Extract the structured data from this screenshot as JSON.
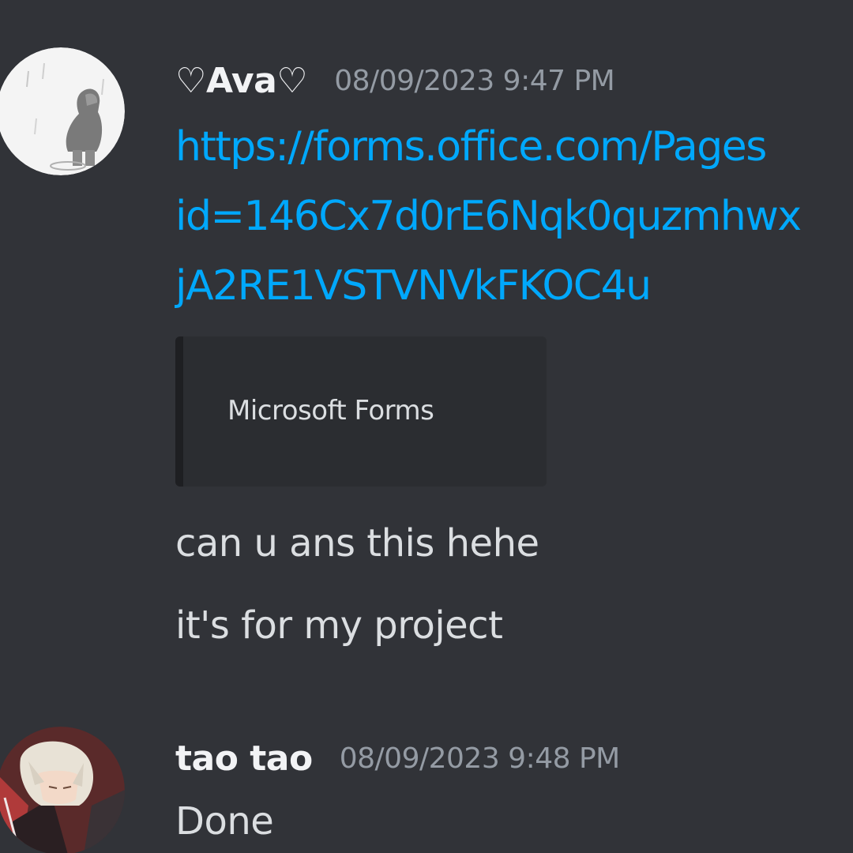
{
  "messages": [
    {
      "username": "♡Ava♡",
      "timestamp": "08/09/2023 9:47 PM",
      "avatar": "sketch-figure-avatar",
      "links": [
        "https://forms.office.com/Pages",
        "id=146Cx7d0rE6Nqk0quzmhwx",
        "jA2RE1VSTVNVkFKOC4u"
      ],
      "embed": {
        "provider": "Microsoft Forms"
      },
      "lines": [
        "can u ans this hehe",
        "it's for my project"
      ]
    },
    {
      "username": "tao tao",
      "timestamp": "08/09/2023 9:48 PM",
      "avatar": "anime-character-avatar",
      "lines": [
        "Done"
      ]
    }
  ],
  "colors": {
    "background": "#313338",
    "link": "#00a8fc",
    "username": "#f2f3f5",
    "timestamp": "#949ba4",
    "text": "#dbdee1",
    "embed_bg": "#2b2d31"
  }
}
